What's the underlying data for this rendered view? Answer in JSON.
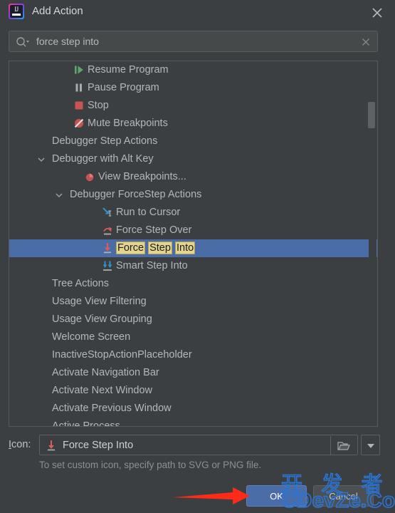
{
  "window": {
    "title": "Add Action",
    "app_icon": "intellij-idea-icon",
    "close_icon": "close-icon"
  },
  "search": {
    "icon": "search-icon",
    "value": "force step into",
    "placeholder": "",
    "clear_icon": "clear-icon"
  },
  "tree": {
    "rows": [
      {
        "label": "Resume Program",
        "indent": 110,
        "icon": "resume-program-icon",
        "chevron": "none"
      },
      {
        "label": "Pause Program",
        "indent": 110,
        "icon": "pause-program-icon",
        "chevron": "none"
      },
      {
        "label": "Stop",
        "indent": 110,
        "icon": "stop-icon",
        "chevron": "none"
      },
      {
        "label": "Mute Breakpoints",
        "indent": 110,
        "icon": "mute-breakpoints-icon",
        "chevron": "none"
      },
      {
        "label": "Debugger Step Actions",
        "indent": 60,
        "icon": "none",
        "chevron": "collapsed"
      },
      {
        "label": "Debugger with Alt Key",
        "indent": 60,
        "icon": "none",
        "chevron": "expanded"
      },
      {
        "label": "View Breakpoints...",
        "indent": 125,
        "icon": "view-breakpoints-icon",
        "chevron": "none"
      },
      {
        "label": "Debugger ForceStep Actions",
        "indent": 85,
        "icon": "none",
        "chevron": "expanded"
      },
      {
        "label": "Run to Cursor",
        "indent": 150,
        "icon": "run-to-cursor-icon",
        "chevron": "none"
      },
      {
        "label": "Force Step Over",
        "indent": 150,
        "icon": "force-step-over-icon",
        "chevron": "none"
      },
      {
        "label": "Force Step Into",
        "indent": 150,
        "icon": "force-step-into-icon",
        "chevron": "none",
        "selected": true,
        "highlight_words": [
          "Force",
          "Step",
          "Into"
        ]
      },
      {
        "label": "Smart Step Into",
        "indent": 150,
        "icon": "smart-step-into-icon",
        "chevron": "none"
      },
      {
        "label": "Tree Actions",
        "indent": 60,
        "icon": "none",
        "chevron": "collapsed"
      },
      {
        "label": "Usage View Filtering",
        "indent": 60,
        "icon": "none",
        "chevron": "collapsed"
      },
      {
        "label": "Usage View Grouping",
        "indent": 60,
        "icon": "none",
        "chevron": "collapsed"
      },
      {
        "label": "Welcome Screen",
        "indent": 60,
        "icon": "none",
        "chevron": "collapsed"
      },
      {
        "label": "InactiveStopActionPlaceholder",
        "indent": 60,
        "icon": "none",
        "chevron": "none"
      },
      {
        "label": "Activate Navigation Bar",
        "indent": 60,
        "icon": "none",
        "chevron": "none"
      },
      {
        "label": "Activate Next Window",
        "indent": 60,
        "icon": "none",
        "chevron": "none"
      },
      {
        "label": "Activate Previous Window",
        "indent": 60,
        "icon": "none",
        "chevron": "none"
      },
      {
        "label": "Active Process",
        "indent": 60,
        "icon": "none",
        "chevron": "none"
      }
    ],
    "scrollbar": "vertical-scrollbar"
  },
  "icon_field": {
    "label_prefix": "I",
    "label_suffix": "con:",
    "value": "Force Step Into",
    "value_icon": "force-step-into-icon",
    "browse_icon": "folder-icon",
    "dropdown_icon": "chevron-down-icon",
    "hint": "To set custom icon, specify path to SVG or PNG file."
  },
  "buttons": {
    "ok": "OK",
    "cancel": "Cancel"
  },
  "annotation": {
    "arrow": "red-arrow-pointing-right",
    "arrow_color": "#ff2a18"
  },
  "watermark": {
    "line1": "开 发 者",
    "line2": "CDevZe.CoM",
    "color": "#2a74d4"
  },
  "colors": {
    "dialog_background": "#3c3f41",
    "field_background": "#45494a",
    "selection": "#4a6da7",
    "match_highlight": "#e3d58c",
    "text": "#b4b7ba",
    "accent": "#4a6da7"
  }
}
